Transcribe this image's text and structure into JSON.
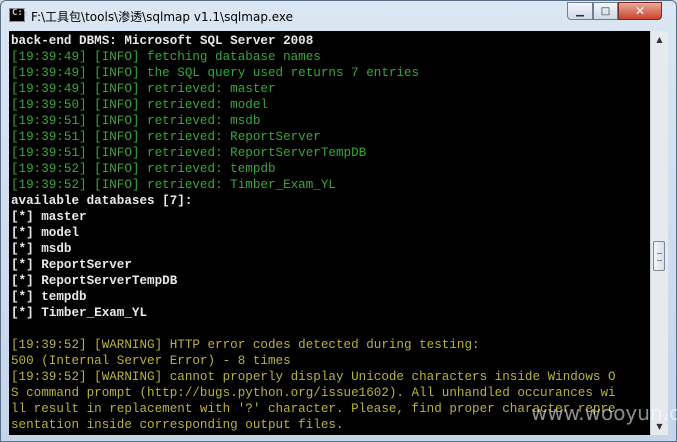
{
  "window": {
    "title": "F:\\工具包\\tools\\渗透\\sqlmap v1.1\\sqlmap.exe",
    "icon_label": "C:\\",
    "minimize_glyph": "▁",
    "maximize_glyph": "□",
    "close_glyph": "✕"
  },
  "console": {
    "lines": [
      {
        "text": "back-end DBMS: Microsoft SQL Server 2008",
        "color": "white"
      },
      {
        "text": "[19:39:49] [INFO] fetching database names",
        "color": "green"
      },
      {
        "text": "[19:39:49] [INFO] the SQL query used returns 7 entries",
        "color": "green"
      },
      {
        "text": "[19:39:49] [INFO] retrieved: master",
        "color": "green"
      },
      {
        "text": "[19:39:50] [INFO] retrieved: model",
        "color": "green"
      },
      {
        "text": "[19:39:51] [INFO] retrieved: msdb",
        "color": "green"
      },
      {
        "text": "[19:39:51] [INFO] retrieved: ReportServer",
        "color": "green"
      },
      {
        "text": "[19:39:51] [INFO] retrieved: ReportServerTempDB",
        "color": "green"
      },
      {
        "text": "[19:39:52] [INFO] retrieved: tempdb",
        "color": "green"
      },
      {
        "text": "[19:39:52] [INFO] retrieved: Timber_Exam_YL",
        "color": "green"
      },
      {
        "text": "available databases [7]:",
        "color": "white"
      },
      {
        "text": "[*] master",
        "color": "white"
      },
      {
        "text": "[*] model",
        "color": "white"
      },
      {
        "text": "[*] msdb",
        "color": "white"
      },
      {
        "text": "[*] ReportServer",
        "color": "white"
      },
      {
        "text": "[*] ReportServerTempDB",
        "color": "white"
      },
      {
        "text": "[*] tempdb",
        "color": "white"
      },
      {
        "text": "[*] Timber_Exam_YL",
        "color": "white"
      },
      {
        "text": "",
        "color": "white"
      },
      {
        "text": "[19:39:52] [WARNING] HTTP error codes detected during testing:",
        "color": "yellow"
      },
      {
        "text": "500 (Internal Server Error) - 8 times",
        "color": "yellow"
      },
      {
        "text": "[19:39:52] [WARNING] cannot properly display Unicode characters inside Windows O",
        "color": "yellow"
      },
      {
        "text": "S command prompt (http://bugs.python.org/issue1602). All unhandled occurances wi",
        "color": "yellow"
      },
      {
        "text": "ll result in replacement with '?' character. Please, find proper character repre",
        "color": "yellow"
      },
      {
        "text": "sentation inside corresponding output files.",
        "color": "yellow"
      }
    ]
  },
  "scrollbar": {
    "up_glyph": "▲",
    "down_glyph": "▼"
  },
  "watermark": "www.wooyun.org"
}
